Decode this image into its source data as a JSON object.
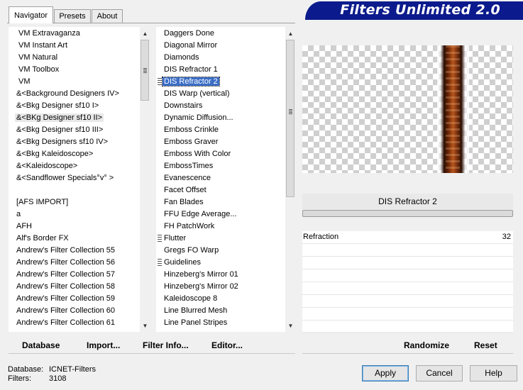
{
  "app": {
    "title": "Filters Unlimited 2.0"
  },
  "tabs": [
    {
      "label": "Navigator"
    },
    {
      "label": "Presets"
    },
    {
      "label": "About"
    }
  ],
  "categories": [
    "VM Extravaganza",
    "VM Instant Art",
    "VM Natural",
    "VM Toolbox",
    "VM",
    "&<Background Designers IV>",
    "&<Bkg Designer sf10 I>",
    "&<BKg Designer sf10 II>",
    "&<Bkg Designer sf10 III>",
    "&<Bkg Designers sf10 IV>",
    "&<Bkg Kaleidoscope>",
    "&<Kaleidoscope>",
    "&<Sandflower Specials°v° >",
    "",
    "[AFS IMPORT]",
    "a",
    "AFH",
    "Alf's Border FX",
    "Andrew's Filter Collection 55",
    "Andrew's Filter Collection 56",
    "Andrew's Filter Collection 57",
    "Andrew's Filter Collection 58",
    "Andrew's Filter Collection 59",
    "Andrew's Filter Collection 60",
    "Andrew's Filter Collection 61"
  ],
  "filters": [
    "Daggers Done",
    "Diagonal Mirror",
    "Diamonds",
    "DIS Refractor 1",
    "DIS Refractor 2",
    "DIS Warp (vertical)",
    "Downstairs",
    "Dynamic Diffusion...",
    "Emboss Crinkle",
    "Emboss Graver",
    "Emboss With Color",
    "EmbossTimes",
    "Evanescence",
    "Facet Offset",
    "Fan Blades",
    "FFU Edge Average...",
    "FH PatchWork",
    "Flutter",
    "Gregs FO Warp",
    "Guidelines",
    "Hinzeberg's Mirror 01",
    "Hinzeberg's Mirror 02",
    "Kaleidoscope 8",
    "Line Blurred Mesh",
    "Line Panel Stripes"
  ],
  "selected_filter": "DIS Refractor 2",
  "parameters": [
    {
      "name": "Refraction",
      "value": "32"
    }
  ],
  "left_buttons": {
    "database": "Database",
    "import": "Import...",
    "filter_info": "Filter Info...",
    "editor": "Editor..."
  },
  "right_buttons": {
    "randomize": "Randomize",
    "reset": "Reset"
  },
  "status": {
    "database_label": "Database:",
    "database_value": "ICNET-Filters",
    "filters_label": "Filters:",
    "filters_value": "3108"
  },
  "dialog": {
    "apply": "Apply",
    "cancel": "Cancel",
    "help": "Help"
  },
  "colors": {
    "banner": "#0b1a8c",
    "selection": "#3b6ec6"
  }
}
